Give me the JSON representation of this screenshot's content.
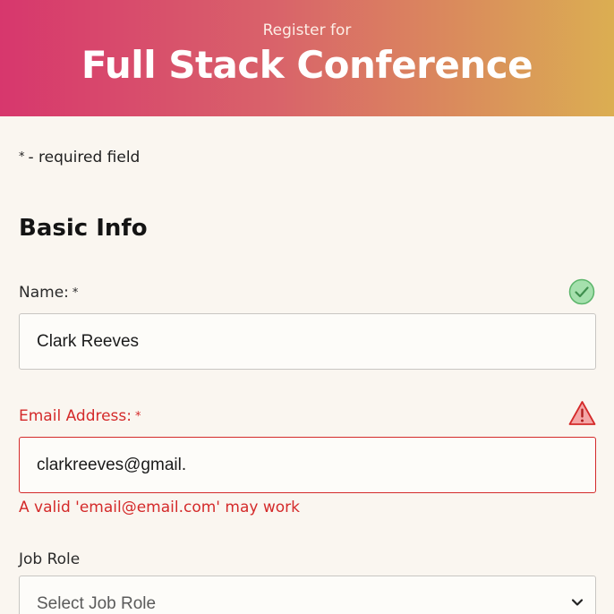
{
  "header": {
    "subtitle": "Register for",
    "title": "Full Stack Conference"
  },
  "form": {
    "required_note": "- required field",
    "required_marker": "*",
    "section_title": "Basic Info",
    "name": {
      "label": "Name:",
      "value": "Clark Reeves",
      "status_icon": "check-circle-icon",
      "status_color": "#7dcf8c"
    },
    "email": {
      "label": "Email Address:",
      "value": "clarkreeves@gmail.",
      "status_icon": "warning-triangle-icon",
      "error_hint": "A valid 'email@email.com' may work",
      "error_color": "#d42a2a"
    },
    "job_role": {
      "label": "Job Role",
      "selected": "Select Job Role"
    }
  },
  "colors": {
    "gradient_start": "#d7376d",
    "gradient_end": "#dbae52",
    "background": "#faf6f0"
  }
}
